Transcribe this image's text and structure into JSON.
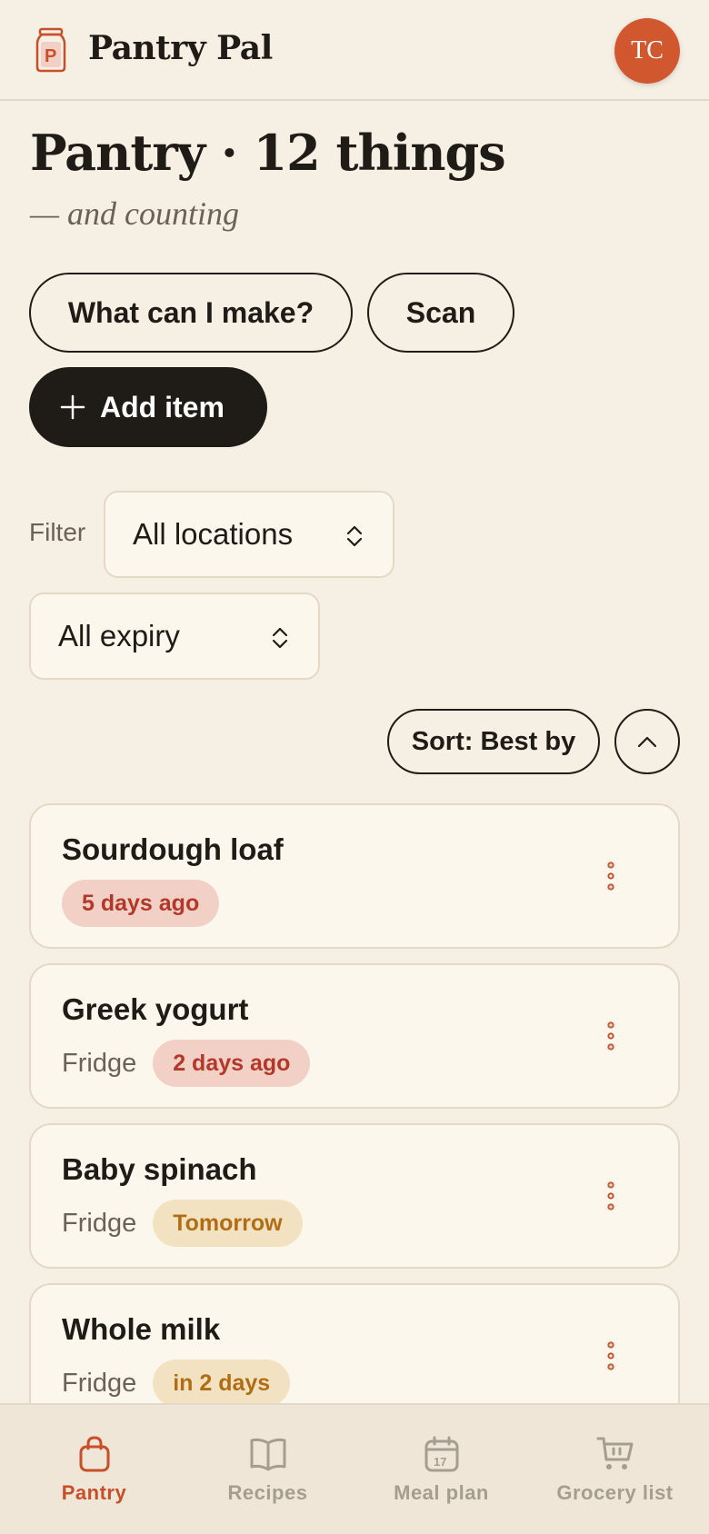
{
  "header": {
    "app_title": "Pantry Pal",
    "avatar_initials": "TC",
    "logo_icon": "pantry-jar-icon"
  },
  "page": {
    "title": "Pantry · 12 things",
    "subtitle": "— and counting"
  },
  "actions": {
    "what_can_i_make": "What can I make?",
    "scan": "Scan",
    "add_item": "Add item"
  },
  "filters": {
    "label": "Filter",
    "location": "All locations",
    "expiry": "All expiry"
  },
  "sort": {
    "label": "Sort: Best by",
    "direction": "ascending"
  },
  "items": [
    {
      "name": "Sourdough loaf",
      "location": "",
      "badge": "5 days ago",
      "status": "expired"
    },
    {
      "name": "Greek yogurt",
      "location": "Fridge",
      "badge": "2 days ago",
      "status": "expired"
    },
    {
      "name": "Baby spinach",
      "location": "Fridge",
      "badge": "Tomorrow",
      "status": "soon"
    },
    {
      "name": "Whole milk",
      "location": "Fridge",
      "badge": "in 2 days",
      "status": "soon"
    }
  ],
  "nav": [
    {
      "label": "Pantry",
      "icon": "bag-icon",
      "active": true
    },
    {
      "label": "Recipes",
      "icon": "book-icon",
      "active": false
    },
    {
      "label": "Meal plan",
      "icon": "calendar-icon",
      "active": false
    },
    {
      "label": "Grocery list",
      "icon": "cart-icon",
      "active": false
    }
  ],
  "colors": {
    "accent": "#c94e2a",
    "background": "#f6efe4",
    "card": "#fcf7ec",
    "expired_bg": "#f2d0c6",
    "expired_text": "#b3382a",
    "soon_bg": "#f3e2c2",
    "soon_text": "#b06d14"
  }
}
